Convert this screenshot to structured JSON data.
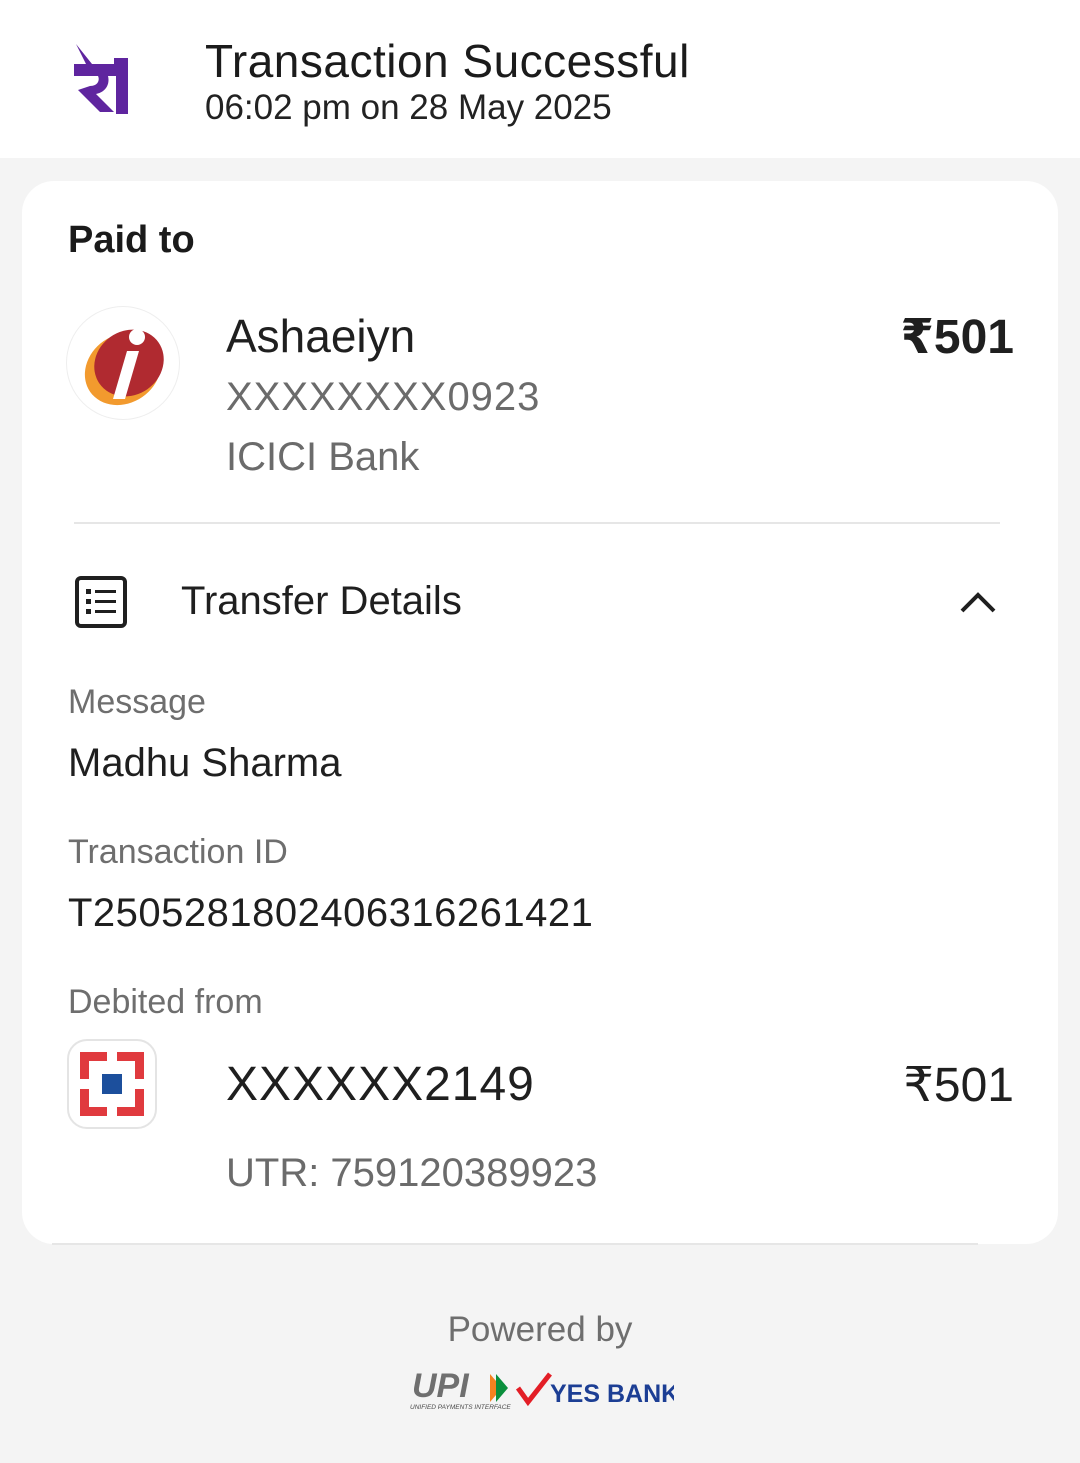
{
  "header": {
    "app_logo_icon": "phonepe-logo-icon",
    "title": "Transaction Successful",
    "timestamp": "06:02 pm on 28 May 2025"
  },
  "paid_to": {
    "label": "Paid to",
    "bank_logo_icon": "icici-bank-logo-icon",
    "name": "Ashaeiyn",
    "account": "XXXXXXXX0923",
    "bank": "ICICI Bank",
    "amount": "₹501"
  },
  "transfer_details": {
    "icon": "receipt-icon",
    "title": "Transfer Details",
    "toggle_icon": "chevron-up-icon",
    "fields": [
      {
        "label": "Message",
        "value": "Madhu Sharma"
      },
      {
        "label": "Transaction ID",
        "value": "T2505281802406316261421"
      }
    ],
    "debited_from": {
      "label": "Debited from",
      "bank_logo_icon": "hdfc-bank-logo-icon",
      "account": "XXXXXX2149",
      "amount": "₹501",
      "utr": "UTR: 759120389923"
    }
  },
  "footer": {
    "powered_by": "Powered by",
    "upi_logo_text": "UPI",
    "upi_tagline": "UNIFIED PAYMENTS INTERFACE",
    "partner_name": "YES BANK"
  },
  "colors": {
    "brand_purple": "#5f259f",
    "icici_red": "#b02a30",
    "icici_orange": "#f29a2e",
    "hdfc_red": "#e03a3e",
    "hdfc_blue": "#1c4f9c",
    "yes_bank_blue": "#1c3e94"
  }
}
